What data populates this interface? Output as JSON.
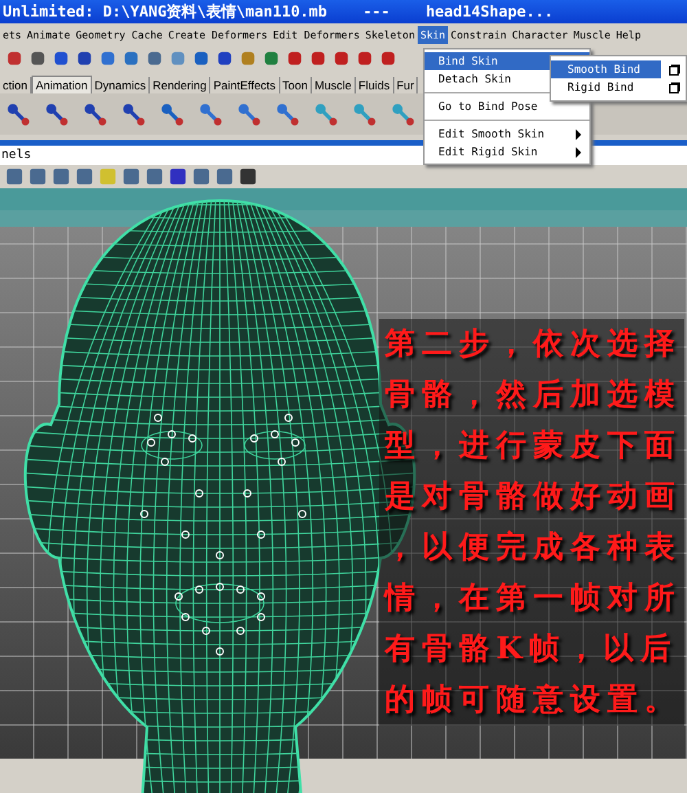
{
  "window": {
    "title_parts": [
      "Unlimited: D:\\YANG资料\\表情\\man110.mb",
      "---",
      "head14Shape..."
    ]
  },
  "menu_bar": [
    {
      "label": "ets",
      "selected": false
    },
    {
      "label": "Animate",
      "selected": false
    },
    {
      "label": "Geometry Cache",
      "selected": false
    },
    {
      "label": "Create Deformers",
      "selected": false
    },
    {
      "label": "Edit Deformers",
      "selected": false
    },
    {
      "label": "Skeleton",
      "selected": false
    },
    {
      "label": "Skin",
      "selected": true
    },
    {
      "label": "Constrain",
      "selected": false
    },
    {
      "label": "Character",
      "selected": false
    },
    {
      "label": "Muscle",
      "selected": false
    },
    {
      "label": "Help",
      "selected": false
    }
  ],
  "shelf_tabs": [
    {
      "label": "ction",
      "selected": false
    },
    {
      "label": "Animation",
      "selected": true
    },
    {
      "label": "Dynamics",
      "selected": false
    },
    {
      "label": "Rendering",
      "selected": false
    },
    {
      "label": "PaintEffects",
      "selected": false
    },
    {
      "label": "Toon",
      "selected": false
    },
    {
      "label": "Muscle",
      "selected": false
    },
    {
      "label": "Fluids",
      "selected": false
    },
    {
      "label": "Fur",
      "selected": false
    }
  ],
  "panel_menu": "nels",
  "skin_menu": [
    {
      "label": "Bind Skin",
      "kind": "submenu",
      "selected": true,
      "divider_before": false
    },
    {
      "label": "Detach Skin",
      "kind": "item",
      "selected": false,
      "divider_before": false
    },
    {
      "label": "Go to Bind Pose",
      "kind": "item",
      "selected": false,
      "divider_before": true
    },
    {
      "label": "Edit Smooth Skin",
      "kind": "submenu",
      "selected": false,
      "divider_before": true
    },
    {
      "label": "Edit Rigid Skin",
      "kind": "submenu",
      "selected": false,
      "divider_before": false
    }
  ],
  "bind_skin_submenu": [
    {
      "label": "Smooth Bind",
      "selected": true
    },
    {
      "label": "Rigid Bind",
      "selected": false
    }
  ],
  "caption": "第二步，依次选择骨骼，然后加选模型，进行蒙皮下面是对骨骼做好动画，以便完成各种表情，在第一帧对所有骨骼K帧，以后的帧可随意设置。"
}
